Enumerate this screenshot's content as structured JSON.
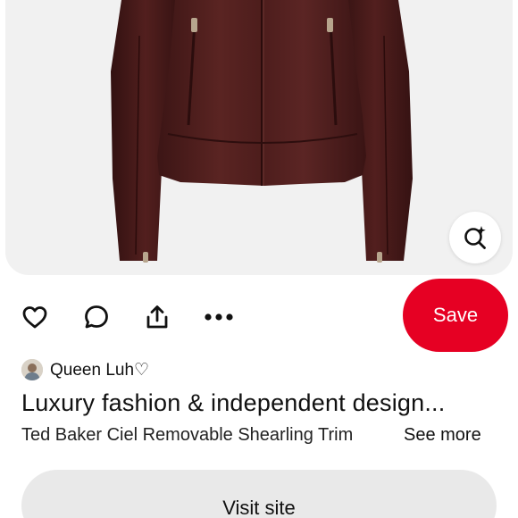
{
  "image": {
    "subject": "burgundy-leather-jacket"
  },
  "actions": {
    "like_icon": "heart-icon",
    "comment_icon": "comment-icon",
    "share_icon": "share-icon",
    "more_icon": "more-dots-icon",
    "lens_icon": "visual-search-icon",
    "save_label": "Save"
  },
  "creator": {
    "name": "Queen Luh♡"
  },
  "pin": {
    "title": "Luxury fashion & independent design...",
    "description": "Ted Baker Ciel Removable Shearling Trim",
    "see_more_label": "See more"
  },
  "visit": {
    "label": "Visit site"
  },
  "colors": {
    "save_bg": "#e60023",
    "jacket": "#4a1c1b",
    "image_bg": "#f1f1f1",
    "visit_bg": "#e9e9e9"
  }
}
